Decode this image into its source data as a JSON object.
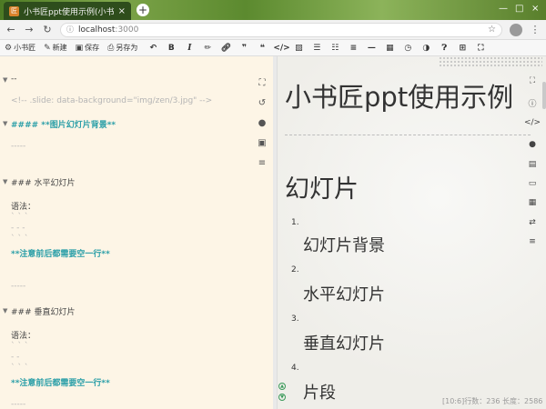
{
  "browser": {
    "tab_title": "小书匠ppt使用示例(小书匠)",
    "tab_close": "×",
    "new_tab": "+",
    "win_min": "—",
    "win_max": "□",
    "win_close": "×",
    "url_host": "localhost",
    "url_port": ":3000"
  },
  "toolbar": {
    "brand": "小书匠",
    "new_label": "新建",
    "save_label": "保存",
    "saveas_label": "另存为"
  },
  "editor": {
    "lines": [
      {
        "text": "--",
        "style": "plain"
      },
      {
        "text": "<!-- .slide: data-background=\"img/zen/3.jpg\" -->",
        "style": "muted"
      },
      {
        "text": "#### **图片幻灯片背景**",
        "style": "teal"
      },
      {
        "text": "-----",
        "style": "muted"
      },
      {
        "text": "### 水平幻灯片",
        "style": "plain"
      },
      {
        "text": "语法：",
        "style": "plain"
      },
      {
        "text": "` ` `",
        "style": "muted"
      },
      {
        "text": "- - -",
        "style": "muted"
      },
      {
        "text": "` ` `",
        "style": "muted"
      },
      {
        "text": "**注意前后都需要空一行**",
        "style": "teal"
      },
      {
        "text": "-----",
        "style": "muted"
      },
      {
        "text": "### 垂直幻灯片",
        "style": "plain"
      },
      {
        "text": "语法：",
        "style": "plain"
      },
      {
        "text": "` ` `",
        "style": "muted"
      },
      {
        "text": "- -",
        "style": "muted"
      },
      {
        "text": "` ` `",
        "style": "muted"
      },
      {
        "text": "**注意前后都需要空一行**",
        "style": "teal"
      },
      {
        "text": "-----",
        "style": "muted"
      }
    ]
  },
  "preview": {
    "title": "小书匠ppt使用示例",
    "heading": "幻灯片",
    "items": [
      {
        "num": "1.",
        "label": "幻灯片背景"
      },
      {
        "num": "2.",
        "label": "水平幻灯片"
      },
      {
        "num": "3.",
        "label": "垂直幻灯片"
      },
      {
        "num": "4.",
        "label": "片段"
      }
    ],
    "status": "[10:6]行数：236 长度：2586"
  }
}
